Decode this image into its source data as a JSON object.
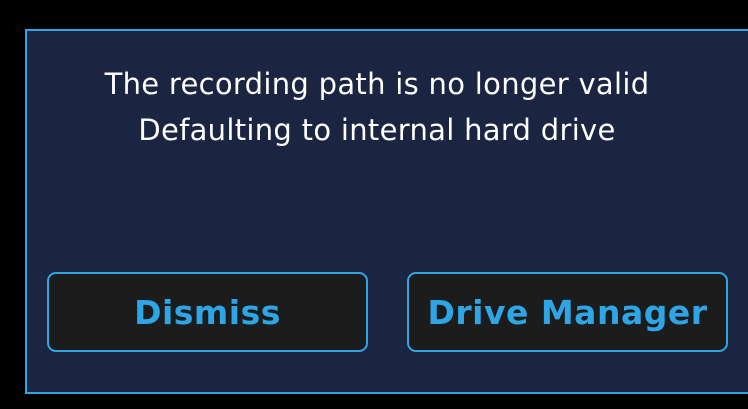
{
  "dialog": {
    "message_line_1": "The recording path is no longer valid",
    "message_line_2": "Defaulting to internal hard drive",
    "dismiss_label": "Dismiss",
    "drive_manager_label": "Drive Manager"
  },
  "colors": {
    "background": "#000000",
    "dialog_background": "#1b2440",
    "accent": "#2ea6e6",
    "button_background": "#1c1c1c",
    "text": "#ffffff"
  }
}
